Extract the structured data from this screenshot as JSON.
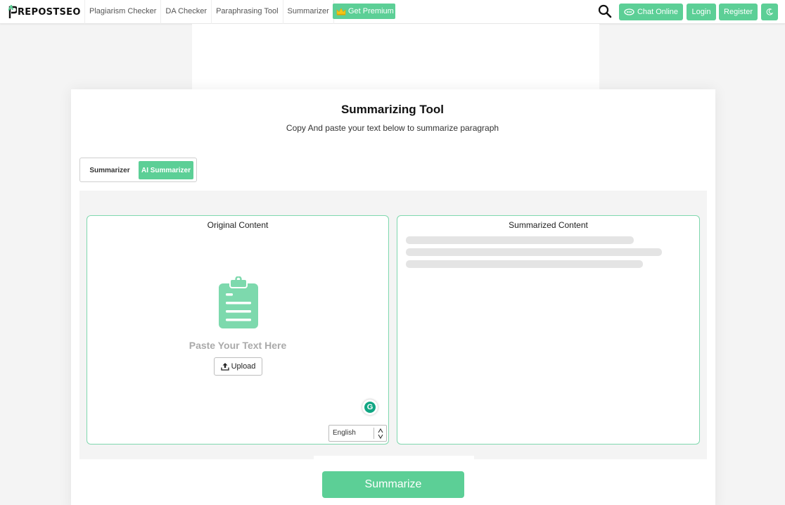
{
  "header": {
    "logo_text": "REPOSTSEO",
    "nav": [
      "Plagiarism Checker",
      "DA Checker",
      "Paraphrasing Tool",
      "Summarizer"
    ],
    "premium_label": "Get Premium",
    "chat_label": "Chat Online",
    "login_label": "Login",
    "register_label": "Register"
  },
  "main": {
    "title": "Summarizing Tool",
    "subtitle": "Copy And paste your text below to summarize paragraph",
    "modes": [
      "Summarizer",
      "AI Summarizer"
    ],
    "active_mode": "AI Summarizer"
  },
  "original": {
    "title": "Original Content",
    "placeholder": "Paste Your Text Here",
    "upload_label": "Upload",
    "language": "English"
  },
  "summarized": {
    "title": "Summarized Content"
  },
  "action": {
    "summarize_label": "Summarize"
  },
  "colors": {
    "accent": "#5ccf96",
    "panel_border": "#7fd8ae",
    "skeleton": "#e4e4e4"
  }
}
